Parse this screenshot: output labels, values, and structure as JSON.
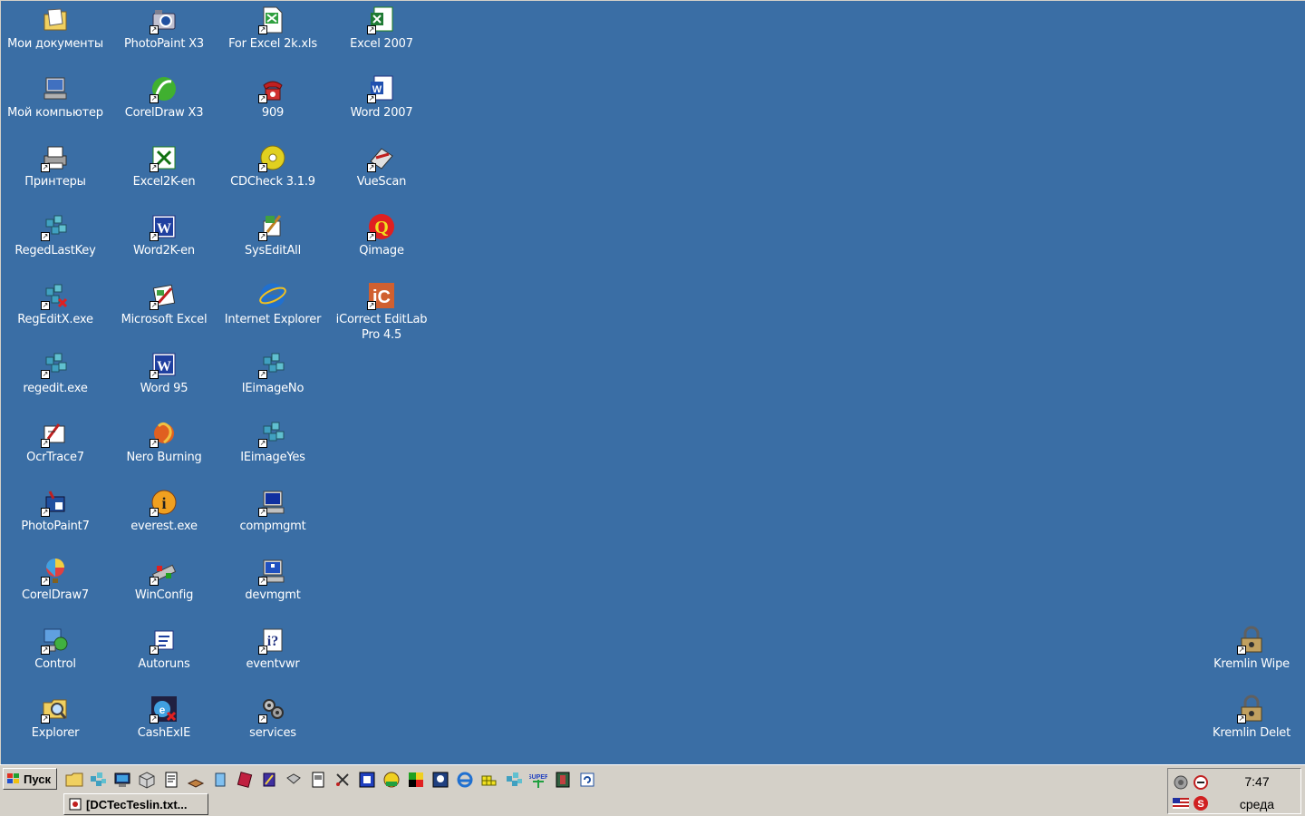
{
  "desktop": {
    "background": "#3a6ea5",
    "icons": [
      {
        "label": "Мои документы",
        "icon": "my-documents-icon",
        "shortcut": false
      },
      {
        "label": "Мой компьютер",
        "icon": "my-computer-icon",
        "shortcut": false
      },
      {
        "label": "Принтеры",
        "icon": "printers-icon",
        "shortcut": true
      },
      {
        "label": "RegedLastKey",
        "icon": "registry-icon",
        "shortcut": true
      },
      {
        "label": "RegEditX.exe",
        "icon": "registry-x-icon",
        "shortcut": true
      },
      {
        "label": "regedit.exe",
        "icon": "registry-icon",
        "shortcut": true
      },
      {
        "label": "OcrTrace7",
        "icon": "ocrtrace-icon",
        "shortcut": true
      },
      {
        "label": "PhotoPaint7",
        "icon": "photopaint-icon",
        "shortcut": true
      },
      {
        "label": "CorelDraw7",
        "icon": "balloon-icon",
        "shortcut": true
      },
      {
        "label": "Control",
        "icon": "control-panel-icon",
        "shortcut": true
      },
      {
        "label": "Explorer",
        "icon": "explorer-icon",
        "shortcut": true
      },
      {
        "label": "PhotoPaint X3",
        "icon": "camera-icon",
        "shortcut": true
      },
      {
        "label": "CorelDraw X3",
        "icon": "coreldraw-icon",
        "shortcut": true
      },
      {
        "label": "Excel2K-en",
        "icon": "excel-icon",
        "shortcut": true
      },
      {
        "label": "Word2K-en",
        "icon": "word-icon",
        "shortcut": true
      },
      {
        "label": "Microsoft Excel",
        "icon": "excel-old-icon",
        "shortcut": true
      },
      {
        "label": "Word 95",
        "icon": "word-icon",
        "shortcut": true
      },
      {
        "label": "Nero Burning",
        "icon": "nero-icon",
        "shortcut": true
      },
      {
        "label": "everest.exe",
        "icon": "info-icon",
        "shortcut": true
      },
      {
        "label": "WinConfig",
        "icon": "winconfig-icon",
        "shortcut": true
      },
      {
        "label": "Autoruns",
        "icon": "autoruns-icon",
        "shortcut": true
      },
      {
        "label": "CashExIE",
        "icon": "cashexie-icon",
        "shortcut": true
      },
      {
        "label": "For Excel 2k.xls",
        "icon": "excel-file-icon",
        "shortcut": true
      },
      {
        "label": "909",
        "icon": "phone-icon",
        "shortcut": true
      },
      {
        "label": "CDCheck 3.1.9",
        "icon": "cd-icon",
        "shortcut": true
      },
      {
        "label": "SysEditAll",
        "icon": "sysedit-icon",
        "shortcut": true
      },
      {
        "label": "Internet Explorer",
        "icon": "ie-icon",
        "shortcut": false
      },
      {
        "label": "IEimageNo",
        "icon": "registry-icon",
        "shortcut": true
      },
      {
        "label": "IEimageYes",
        "icon": "registry-icon",
        "shortcut": true
      },
      {
        "label": "compmgmt",
        "icon": "computer-management-icon",
        "shortcut": true
      },
      {
        "label": "devmgmt",
        "icon": "device-manager-icon",
        "shortcut": true
      },
      {
        "label": "eventvwr",
        "icon": "event-viewer-icon",
        "shortcut": true
      },
      {
        "label": "services",
        "icon": "services-icon",
        "shortcut": true
      },
      {
        "label": "Excel 2007",
        "icon": "excel-2007-icon",
        "shortcut": true
      },
      {
        "label": "Word 2007",
        "icon": "word-2007-icon",
        "shortcut": true
      },
      {
        "label": "VueScan",
        "icon": "vuescan-icon",
        "shortcut": true
      },
      {
        "label": "Qimage",
        "icon": "qimage-icon",
        "shortcut": true
      },
      {
        "label": "iCorrect EditLab Pro 4.5",
        "icon": "icorrect-icon",
        "shortcut": true
      },
      {
        "label": "Kremlin Wipe",
        "icon": "lock-icon",
        "shortcut": true
      },
      {
        "label": "Kremlin Delet",
        "icon": "lock-icon",
        "shortcut": true
      }
    ]
  },
  "taskbar": {
    "start_label": "Пуск",
    "quick_launch": [
      "folder-icon",
      "registry-icon",
      "monitor-icon",
      "cube-icon",
      "notepad-icon",
      "book-icon",
      "glass-icon",
      "red-book-icon",
      "purple-icon",
      "tools-icon",
      "document-icon",
      "scissors-icon",
      "blue-square-icon",
      "smiley-icon",
      "color-grid-icon",
      "portrait-icon",
      "ie-icon",
      "yellow-grid-icon",
      "registry-icon",
      "super-icon",
      "film-icon",
      "refresh-icon"
    ],
    "task_button": "[DCTecTeslin.txt...",
    "clock_time": "7:47",
    "clock_day": "среда"
  }
}
